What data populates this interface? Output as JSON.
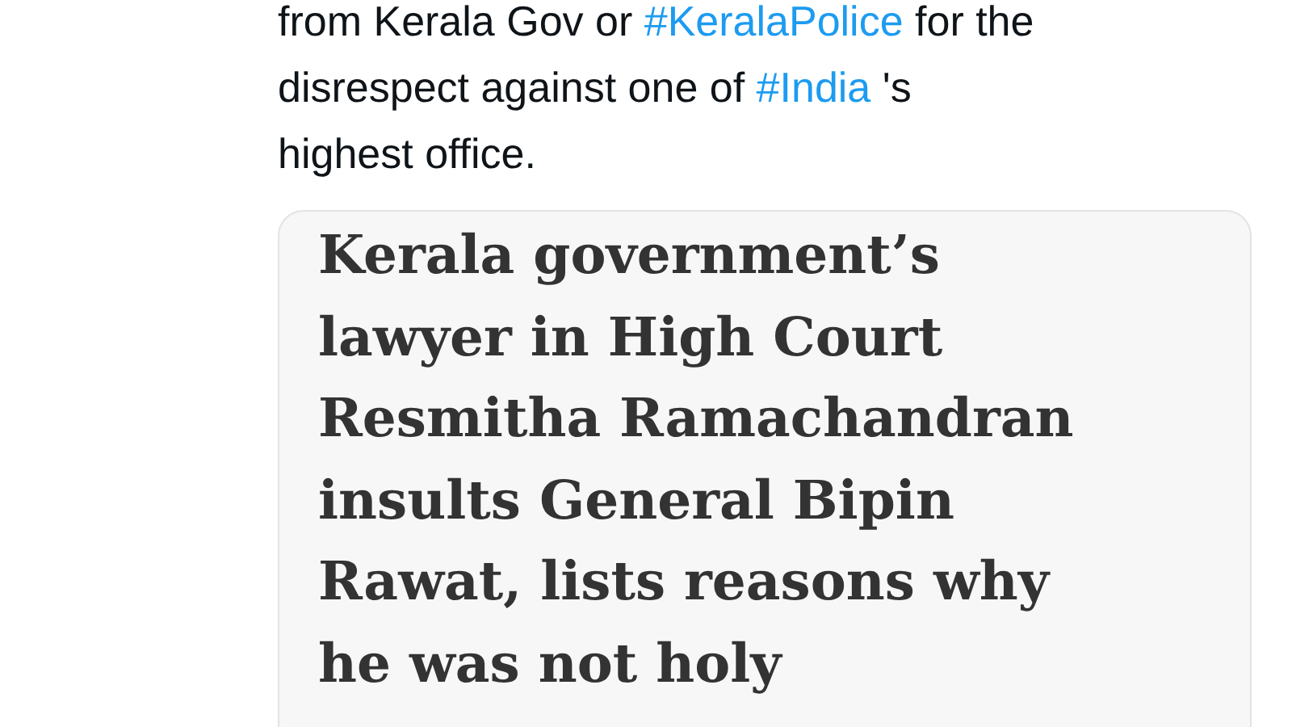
{
  "tweet": {
    "lines": [
      [
        {
          "kind": "text",
          "text": "from Kerala Gov or "
        },
        {
          "kind": "hashtag",
          "text": "#KeralaPolice"
        },
        {
          "kind": "text",
          "text": " for the"
        }
      ],
      [
        {
          "kind": "text",
          "text": "disrespect against one of "
        },
        {
          "kind": "hashtag",
          "text": "#India"
        },
        {
          "kind": "text",
          "text": " 's"
        }
      ],
      [
        {
          "kind": "text",
          "text": "highest office."
        }
      ]
    ]
  },
  "card": {
    "headline_lines": [
      "Kerala government’s",
      "lawyer in High Court",
      "Resmitha Ramachandran",
      "insults General Bipin",
      "Rawat, lists reasons why",
      "he was not holy"
    ]
  }
}
